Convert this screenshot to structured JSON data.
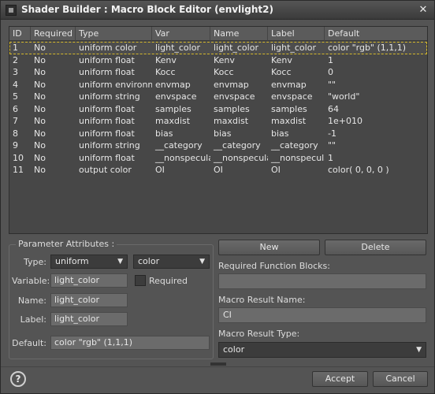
{
  "window": {
    "title": "Shader Builder : Macro Block Editor (envlight2)",
    "close_glyph": "✕"
  },
  "table": {
    "columns": [
      "ID",
      "Required",
      "Type",
      "Var",
      "Name",
      "Label",
      "Default"
    ],
    "rows": [
      [
        "1",
        "No",
        "uniform color",
        "light_color",
        "light_color",
        "light_color",
        "color \"rgb\" (1,1,1)"
      ],
      [
        "2",
        "No",
        "uniform float",
        "Kenv",
        "Kenv",
        "Kenv",
        "1"
      ],
      [
        "3",
        "No",
        "uniform float",
        "Kocc",
        "Kocc",
        "Kocc",
        "0"
      ],
      [
        "4",
        "No",
        "uniform environment",
        "envmap",
        "envmap",
        "envmap",
        "\"\""
      ],
      [
        "5",
        "No",
        "uniform string",
        "envspace",
        "envspace",
        "envspace",
        "\"world\""
      ],
      [
        "6",
        "No",
        "uniform float",
        "samples",
        "samples",
        "samples",
        "64"
      ],
      [
        "7",
        "No",
        "uniform float",
        "maxdist",
        "maxdist",
        "maxdist",
        "1e+010"
      ],
      [
        "8",
        "No",
        "uniform float",
        "bias",
        "bias",
        "bias",
        "-1"
      ],
      [
        "9",
        "No",
        "uniform string",
        "__category",
        "__category",
        "__category",
        "\"\""
      ],
      [
        "10",
        "No",
        "uniform float",
        "__nonspecular",
        "__nonspecular",
        "__nonspecular",
        "1"
      ],
      [
        "11",
        "No",
        "output color",
        "OI",
        "OI",
        "OI",
        "color( 0, 0, 0 )"
      ]
    ],
    "selected_row": 0
  },
  "param": {
    "legend": "Parameter Attributes :",
    "type_label": "Type:",
    "type_value": "uniform",
    "type2_value": "color",
    "variable_label": "Variable:",
    "variable_value": "light_color",
    "required_label": "Required",
    "name_label": "Name:",
    "name_value": "light_color",
    "label_label": "Label:",
    "label_value": "light_color",
    "default_label": "Default:",
    "default_value": "color \"rgb\" (1,1,1)"
  },
  "right": {
    "new_label": "New",
    "delete_label": "Delete",
    "required_blocks_label": "Required Function Blocks:",
    "required_blocks_value": "",
    "result_name_label": "Macro Result Name:",
    "result_name_value": "CI",
    "result_type_label": "Macro Result Type:",
    "result_type_value": "color"
  },
  "footer": {
    "help_glyph": "?",
    "accept_label": "Accept",
    "cancel_label": "Cancel"
  },
  "icons": {
    "dropdown_arrow": "▼"
  }
}
